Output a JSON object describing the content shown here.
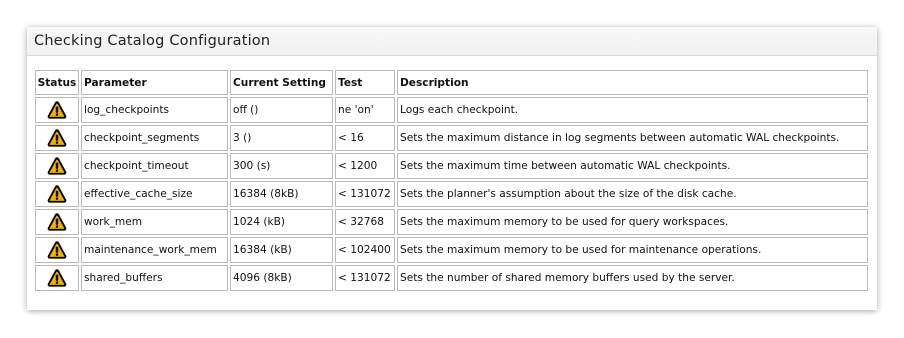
{
  "panel": {
    "title": "Checking Catalog Configuration"
  },
  "table": {
    "headers": {
      "status": "Status",
      "parameter": "Parameter",
      "current_setting": "Current Setting",
      "test": "Test",
      "description": "Description"
    },
    "status_icon": "warning-icon",
    "warning_color": "#f2b100",
    "rows": [
      {
        "parameter": "log_checkpoints",
        "current_setting": "off ()",
        "test": "ne 'on'",
        "description": "Logs each checkpoint."
      },
      {
        "parameter": "checkpoint_segments",
        "current_setting": "3 ()",
        "test": "< 16",
        "description": "Sets the maximum distance in log segments between automatic WAL checkpoints."
      },
      {
        "parameter": "checkpoint_timeout",
        "current_setting": "300 (s)",
        "test": "< 1200",
        "description": "Sets the maximum time between automatic WAL checkpoints."
      },
      {
        "parameter": "effective_cache_size",
        "current_setting": "16384 (8kB)",
        "test": "< 131072",
        "description": "Sets the planner's assumption about the size of the disk cache."
      },
      {
        "parameter": "work_mem",
        "current_setting": "1024 (kB)",
        "test": "< 32768",
        "description": "Sets the maximum memory to be used for query workspaces."
      },
      {
        "parameter": "maintenance_work_mem",
        "current_setting": "16384 (kB)",
        "test": "< 102400",
        "description": "Sets the maximum memory to be used for maintenance operations."
      },
      {
        "parameter": "shared_buffers",
        "current_setting": "4096 (8kB)",
        "test": "< 131072",
        "description": "Sets the number of shared memory buffers used by the server."
      }
    ]
  }
}
